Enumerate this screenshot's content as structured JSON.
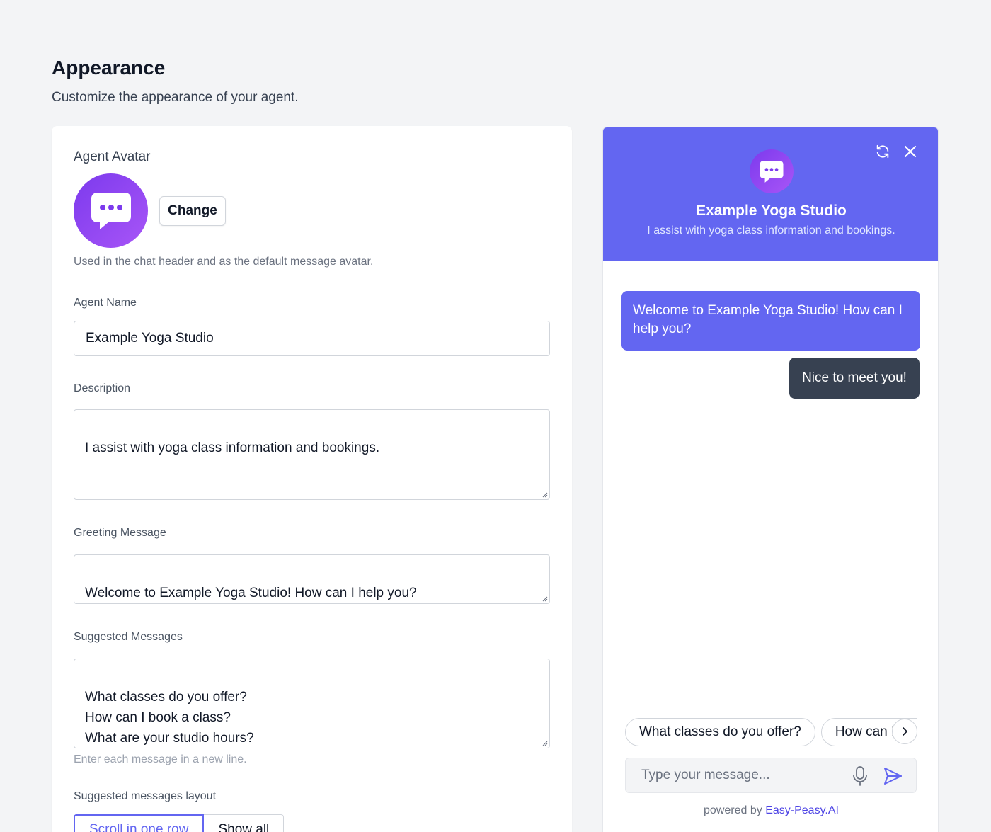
{
  "page": {
    "title": "Appearance",
    "subtitle": "Customize the appearance of your agent."
  },
  "settings": {
    "avatar_label": "Agent Avatar",
    "change_label": "Change",
    "avatar_help": "Used in the chat header and as the default message avatar.",
    "name_label": "Agent Name",
    "name_value": "Example Yoga Studio",
    "description_label": "Description",
    "description_value": "I assist with yoga class information and bookings.",
    "greeting_label": "Greeting Message",
    "greeting_value": "Welcome to Example Yoga Studio! How can I help you?",
    "suggested_label": "Suggested Messages",
    "suggested_value": "What classes do you offer?\nHow can I book a class?\nWhat are your studio hours?",
    "suggested_help": "Enter each message in a new line.",
    "layout_label": "Suggested messages layout",
    "layout_options": [
      "Scroll in one row",
      "Show all"
    ]
  },
  "chat": {
    "title": "Example Yoga Studio",
    "subtitle": "I assist with yoga class information and bookings.",
    "bot_message": "Welcome to Example Yoga Studio! How can I help you?",
    "user_message": "Nice to meet you!",
    "suggestions": [
      "What classes do you offer?",
      "How can I book a class?"
    ],
    "input_placeholder": "Type your message...",
    "powered_prefix": "powered by",
    "powered_brand": "Easy-Peasy.AI"
  },
  "icons": {
    "refresh": "refresh-icon",
    "close": "close-icon",
    "chat": "chat-bubble-icon",
    "mic": "microphone-icon",
    "send": "send-icon",
    "chevron": "chevron-right-icon"
  },
  "colors": {
    "accent": "#6366f1",
    "avatar_gradient_start": "#7c3aed",
    "avatar_gradient_end": "#a855f7",
    "user_bubble": "#374151",
    "brand_link": "#4f46e5"
  }
}
